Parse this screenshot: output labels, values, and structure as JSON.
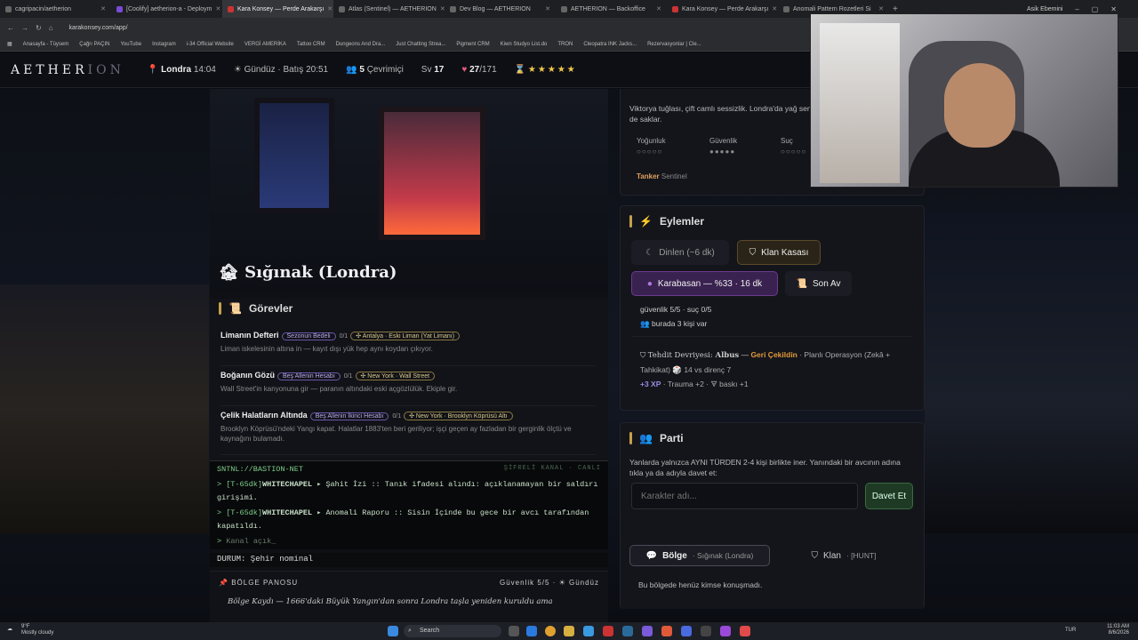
{
  "browser": {
    "tabs": [
      {
        "label": "cagripacin/aetherion"
      },
      {
        "label": "[Coolify] aetherion-a - Deploym"
      },
      {
        "label": "Kara Konsey — Perde Arakarşı"
      },
      {
        "label": "Atlas (Sentinel) — AETHERION"
      },
      {
        "label": "Dev Blog — AETHERION"
      },
      {
        "label": "AETHERION — Backoffice"
      },
      {
        "label": "Kara Konsey — Perde Arakarşı"
      },
      {
        "label": "Anomali Pattern Rozetleri Si"
      }
    ],
    "url": "karakonsey.com/app/",
    "profile": "Asik Ebemini",
    "bookmarks": [
      "Anasayfa - Tüysem",
      "Çağrı PAÇIN",
      "YouTube",
      "Instagram",
      "i-34 Official Website",
      "VERGİ AMERİKA",
      "Tattoo CRM",
      "Dungeons And Dra...",
      "Just Chatting Strea...",
      "Pigment CRM",
      "Kiwn Studyo List.do",
      "TRON",
      "Cleopatra INK Jacks...",
      "Rezervasyonlar | Cle..."
    ]
  },
  "header": {
    "logo_main": "AETHER",
    "logo_dim": "ION",
    "city": "Londra",
    "time": "14:04",
    "daytime": "Gündüz · Batış 20:51",
    "online_count": "5",
    "online_label": "Çevrimiçi",
    "level_label": "Sv",
    "level": "17",
    "hp": "27",
    "hp_max": "/171",
    "stars": "★★★★★"
  },
  "hero": {
    "title": "🏚 Sığınak (Londra)"
  },
  "quests": {
    "title": "Görevler",
    "items": [
      {
        "name": "Limanın Defteri",
        "badge": "Sezonun Bedeli",
        "count": "0/1",
        "loc": "✣ Antalya · Eski Liman (Yat Limanı)",
        "desc": "Liman iskelesinin altına in — kayıt dışı yük hep aynı koydan çıkıyor."
      },
      {
        "name": "Boğanın Gözü",
        "badge": "Beş Allenin Hesabı",
        "count": "0/1",
        "loc": "✣ New York · Wall Street",
        "desc": "Wall Street'in kanyonuna gir — paranın altındaki eski açgözlülük. Ekiple gir."
      },
      {
        "name": "Çelik Halatların Altında",
        "badge": "Beş Allenin İkinci Hesabı",
        "count": "0/1",
        "loc": "✣ New York · Brooklyn Köprüsü Altı",
        "desc": "Brooklyn Köprüsü'ndeki Yangı kapat. Halatlar 1883'ten beri geriliyor; işçi geçen ay fazladan bir gerginlik ölçtü ve kaynağını bulamadı."
      }
    ]
  },
  "terminal": {
    "header": "SNTNL://BASTION-NET",
    "header_right": "ŞİFRELİ KANAL · CANLI",
    "lines": [
      {
        "prefix": "> [T-65dk]",
        "src": "WHITECHAPEL",
        "text": "▸ Şahit İzi :: Tanık ifadesi alındı: açıklanamayan bir saldırı girişimi."
      },
      {
        "prefix": "> [T-65dk]",
        "src": "WHITECHAPEL",
        "text": "▸ Anomali Raporu :: Sisin İçinde bu gece bir avcı tarafından kapatıldı."
      },
      {
        "prefix": ">",
        "src": "",
        "text": "Kanal açık_"
      }
    ],
    "status": "DURUM: Şehir nominal"
  },
  "board": {
    "title": "BÖLGE PANOSU",
    "right": "Güvenlik 5/5 · ☀ Gündüz",
    "text": "Bölge Kaydı — 1666'daki Büyük Yangın'dan sonra Londra taşla yeniden kuruldu ama"
  },
  "location_card": {
    "desc": "Viktorya tuğlası, çift camlı sessizlik. Londra'da yağ seni de saklar.",
    "stats": [
      {
        "label": "Yoğunluk",
        "dots": "○○○○○"
      },
      {
        "label": "Güvenlik",
        "dots": "●●●●●"
      },
      {
        "label": "Suç",
        "dots": "○○○○○"
      }
    ],
    "tag": "Tanker",
    "tag_sub": "Sentinel"
  },
  "actions": {
    "title": "Eylemler",
    "rest": "Dinlen (~6 dk)",
    "vault": "Klan Kasası",
    "karabasan": "Karabasan — %33 · 16 dk",
    "last_hunt": "Son Av",
    "log1": "güvenlik 5/5 · suç 0/5",
    "log2": "burada 3 kişi var",
    "threat_prefix": "Tehdit Devriyesi: ",
    "threat_name": "Albus",
    "threat_mid": " — ",
    "threat_retreat": "Geri Çekildin",
    "threat_rest": " · Planlı Operasyon (Zekâ + Tahkikat) 🎲 14 vs direnç 7",
    "xp": "+3 XP",
    "trauma": " · Trauma +2 · 🜃 baskı +1"
  },
  "party": {
    "title": "Parti",
    "desc": "Yanlarda yalnızca AYNI TÜRDEN 2-4 kişi birlikte iner. Yanındaki bir avcının adına tıkla ya da adıyla davet et:",
    "placeholder": "Karakter adı...",
    "invite": "Davet Et"
  },
  "chat": {
    "tab_region": "Bölge",
    "tab_region_sub": "· Sığınak (Londra)",
    "tab_clan": "Klan",
    "tab_clan_sub": "· [HUNT]",
    "empty": "Bu bölgede henüz kimse konuşmadı."
  },
  "taskbar": {
    "weather_temp": "9°F",
    "weather_desc": "Mostly cloudy",
    "search": "Search",
    "lang": "TUR",
    "time": "11:03 AM",
    "date": "8/6/2026"
  },
  "colors": {
    "accent_gold": "#c4a04a",
    "accent_purple": "#6a5aa8",
    "terminal_green": "#7fd08a",
    "retreat_orange": "#e09a3a"
  }
}
